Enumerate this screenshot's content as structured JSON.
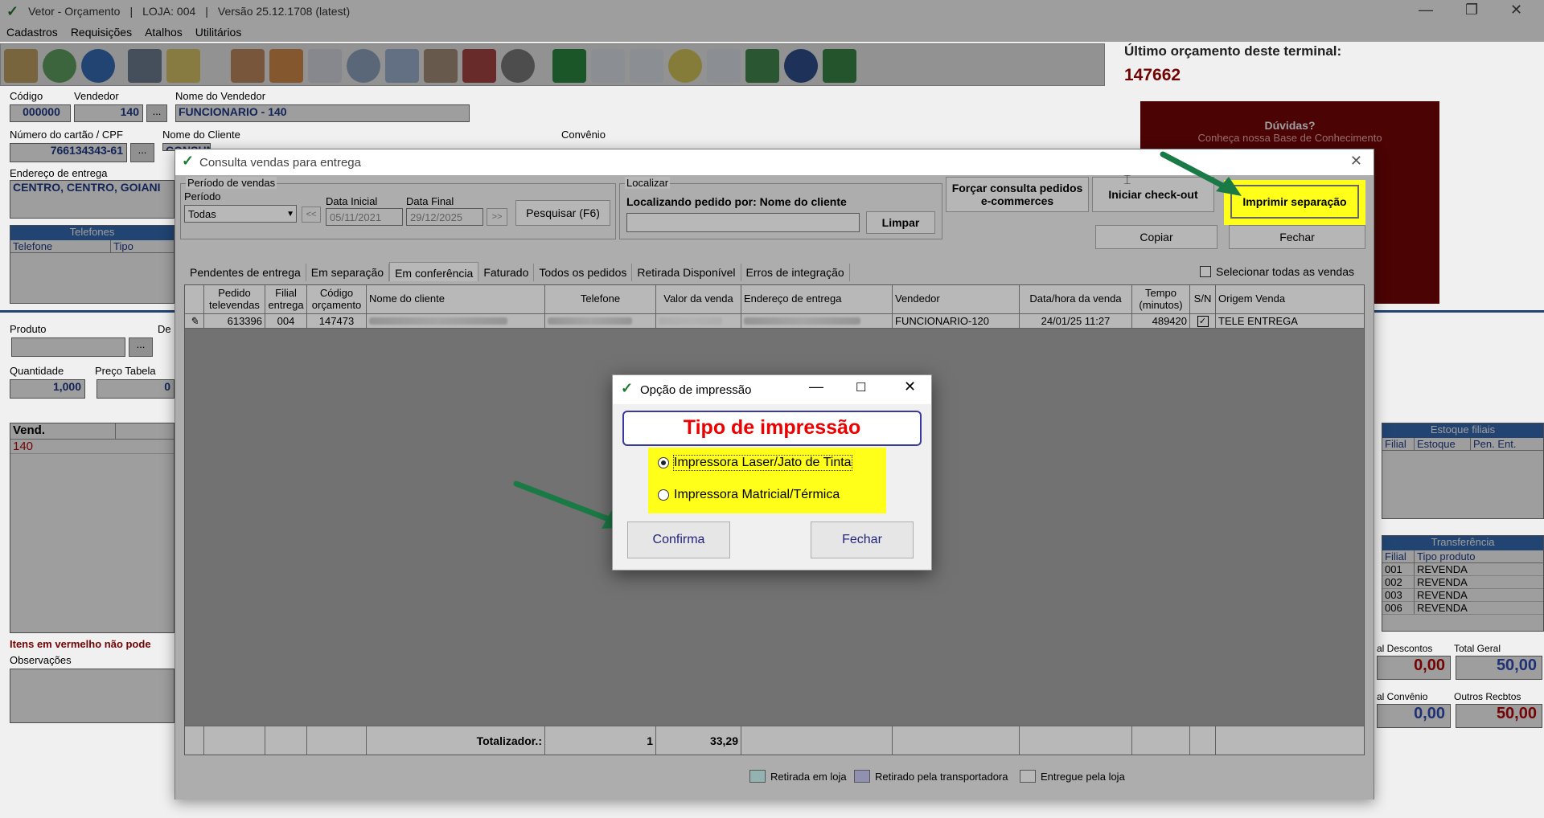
{
  "app": {
    "title": "Vetor - Orçamento",
    "loja": "LOJA: 004",
    "versao": "Versão 25.12.1708 (latest)",
    "sep": "|",
    "menu": [
      "Cadastros",
      "Requisições",
      "Atalhos",
      "Utilitários"
    ],
    "ultimo_label": "Último orçamento deste terminal:",
    "ultimo_value": "147662",
    "duvidas_title": "Dúvidas?",
    "duvidas_sub": "Conheça nossa Base de Conhecimento"
  },
  "form": {
    "codigo_label": "Código",
    "codigo": "000000",
    "vendedor_label": "Vendedor",
    "vendedor": "140",
    "nome_vendedor_label": "Nome do Vendedor",
    "nome_vendedor": "FUNCIONARIO - 140",
    "cartao_label": "Número do cartão / CPF",
    "cartao": "766134343-61",
    "nome_cliente_label": "Nome do Cliente",
    "nome_cliente": "CONSUMIDOR FINAL",
    "convenio_label": "Convênio",
    "endereco_label": "Endereço de entrega",
    "endereco": "CENTRO, CENTRO, GOIANI",
    "telefones_label": "Telefones",
    "telefone_col": "Telefone",
    "tipo_col": "Tipo",
    "produto_label": "Produto",
    "de_label": "De",
    "quantidade_label": "Quantidade",
    "quantidade": "1,000",
    "preco_label": "Preço Tabela",
    "preco": "0",
    "vend_col": "Vend.",
    "vend_value": "140",
    "itens_msg": "Itens em vermelho não pode",
    "observacoes_label": "Observações",
    "dots": "..."
  },
  "right": {
    "estoque_title": "Estoque filiais",
    "estoque_cols": [
      "Filial",
      "Estoque",
      "Pen. Ent."
    ],
    "transf_title": "Transferência",
    "transf_cols": [
      "Filial",
      "Tipo produto"
    ],
    "transf_rows": [
      {
        "filial": "001",
        "tipo": "REVENDA"
      },
      {
        "filial": "002",
        "tipo": "REVENDA"
      },
      {
        "filial": "003",
        "tipo": "REVENDA"
      },
      {
        "filial": "006",
        "tipo": "REVENDA"
      }
    ],
    "descontos_label": "al Descontos",
    "descontos": "0,00",
    "total_label": "Total Geral",
    "total": "50,00",
    "convenio_label": "al Convênio",
    "convenio": "0,00",
    "outros_label": "Outros Recbtos",
    "outros": "50,00"
  },
  "dialog": {
    "title": "Consulta vendas para entrega",
    "periodo_group": "Período de vendas",
    "periodo_label": "Período",
    "periodo_value": "Todas",
    "prev": "<<",
    "next": ">>",
    "data_inicial_label": "Data Inicial",
    "data_inicial": "05/11/2021",
    "data_final_label": "Data Final",
    "data_final": "29/12/2025",
    "pesquisar": "Pesquisar (F6)",
    "localizar_group": "Localizar",
    "localizar_text": "Localizando pedido por: Nome do cliente",
    "limpar": "Limpar",
    "forcar": "Forçar consulta pedidos e-commerces",
    "checkout": "Iniciar check-out",
    "imprimir": "Imprimir separação",
    "copiar": "Copiar",
    "fechar": "Fechar",
    "tabs": [
      "Pendentes de entrega",
      "Em separação",
      "Em conferência",
      "Faturado",
      "Todos os pedidos",
      "Retirada Disponível",
      "Erros de integração"
    ],
    "selecionar_todas": "Selecionar todas as vendas",
    "columns": [
      "Pedido televendas",
      "Filial entrega",
      "Código orçamento",
      "Nome do cliente",
      "Telefone",
      "Valor da venda",
      "Endereço de entrega",
      "Vendedor",
      "Data/hora da venda",
      "Tempo (minutos)",
      "S/N",
      "Origem Venda"
    ],
    "row": {
      "pedido": "613396",
      "filial": "004",
      "codigo": "147473",
      "vendedor": "FUNCIONARIO-120",
      "data": "24/01/25 11:27",
      "tempo": "489420",
      "origem": "TELE ENTREGA"
    },
    "totalizador_label": "Totalizador.:",
    "totalizador_count": "1",
    "totalizador_value": "33,29",
    "legend": [
      "Retirada em loja",
      "Retirado pela transportadora",
      "Entregue pela loja"
    ],
    "legend_colors": [
      "#ccf7f7",
      "#c8c8f5",
      "#ffffff"
    ]
  },
  "print_dialog": {
    "title": "Opção de impressão",
    "heading": "Tipo de impressão",
    "option1": "Impressora Laser/Jato de Tinta",
    "option2": "Impressora Matricial/Térmica",
    "selected": "option1",
    "confirma": "Confirma",
    "fechar": "Fechar"
  },
  "colors": {
    "highlight": "#ffff1a",
    "arrow": "#1a7a45",
    "red": "#d30000",
    "blue": "#1a3a9a",
    "maroon": "#7a0000"
  },
  "icons": [
    "vetor-logo-icon",
    "minimize-icon",
    "maximize-icon",
    "close-icon"
  ]
}
